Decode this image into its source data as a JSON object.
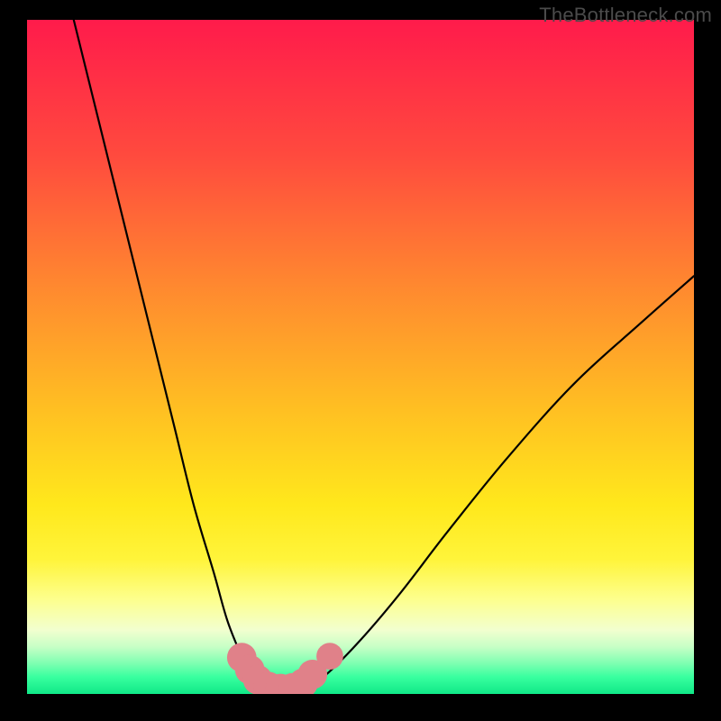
{
  "watermark": "TheBottleneck.com",
  "chart_data": {
    "type": "line",
    "title": "",
    "xlabel": "",
    "ylabel": "",
    "xlim": [
      0,
      100
    ],
    "ylim": [
      0,
      100
    ],
    "grid": false,
    "background": {
      "type": "vertical-gradient",
      "stops": [
        {
          "pos": 0.0,
          "color": "#ff1b4b"
        },
        {
          "pos": 0.2,
          "color": "#ff4a3e"
        },
        {
          "pos": 0.4,
          "color": "#ff8a2f"
        },
        {
          "pos": 0.58,
          "color": "#ffc022"
        },
        {
          "pos": 0.72,
          "color": "#ffe81c"
        },
        {
          "pos": 0.8,
          "color": "#fff43a"
        },
        {
          "pos": 0.86,
          "color": "#fdff8e"
        },
        {
          "pos": 0.905,
          "color": "#f2ffcf"
        },
        {
          "pos": 0.93,
          "color": "#c7ffc6"
        },
        {
          "pos": 0.955,
          "color": "#7dffb1"
        },
        {
          "pos": 0.975,
          "color": "#38ff9f"
        },
        {
          "pos": 1.0,
          "color": "#10e887"
        }
      ]
    },
    "series": [
      {
        "name": "left-branch",
        "stroke": "#000000",
        "x": [
          7.0,
          10.0,
          14.0,
          18.0,
          22.0,
          25.0,
          28.0,
          30.0,
          32.0,
          33.5,
          35.0
        ],
        "y": [
          100.0,
          88.0,
          72.0,
          56.0,
          40.0,
          28.0,
          18.0,
          11.0,
          6.0,
          3.0,
          1.0
        ]
      },
      {
        "name": "right-branch",
        "stroke": "#000000",
        "x": [
          42.0,
          45.0,
          50.0,
          56.0,
          63.0,
          72.0,
          82.0,
          92.0,
          100.0
        ],
        "y": [
          1.0,
          3.0,
          8.0,
          15.0,
          24.0,
          35.0,
          46.0,
          55.0,
          62.0
        ]
      }
    ],
    "markers": [
      {
        "name": "trough-A",
        "color": "#e08189",
        "x": 32.2,
        "y": 5.4,
        "r": 1.4
      },
      {
        "name": "trough-B",
        "color": "#e08189",
        "x": 33.4,
        "y": 3.6,
        "r": 1.4
      },
      {
        "name": "trough-C",
        "color": "#e08189",
        "x": 34.6,
        "y": 2.1,
        "r": 1.4
      },
      {
        "name": "trough-D",
        "color": "#e08189",
        "x": 36.2,
        "y": 1.1,
        "r": 1.4
      },
      {
        "name": "trough-E",
        "color": "#e08189",
        "x": 38.0,
        "y": 0.8,
        "r": 1.4
      },
      {
        "name": "trough-F",
        "color": "#e08189",
        "x": 39.8,
        "y": 0.9,
        "r": 1.4
      },
      {
        "name": "trough-G",
        "color": "#e08189",
        "x": 41.4,
        "y": 1.6,
        "r": 1.4
      },
      {
        "name": "trough-H",
        "color": "#e08189",
        "x": 42.8,
        "y": 2.9,
        "r": 1.4
      },
      {
        "name": "trough-I",
        "color": "#e08189",
        "x": 45.4,
        "y": 5.6,
        "r": 1.2
      }
    ]
  }
}
